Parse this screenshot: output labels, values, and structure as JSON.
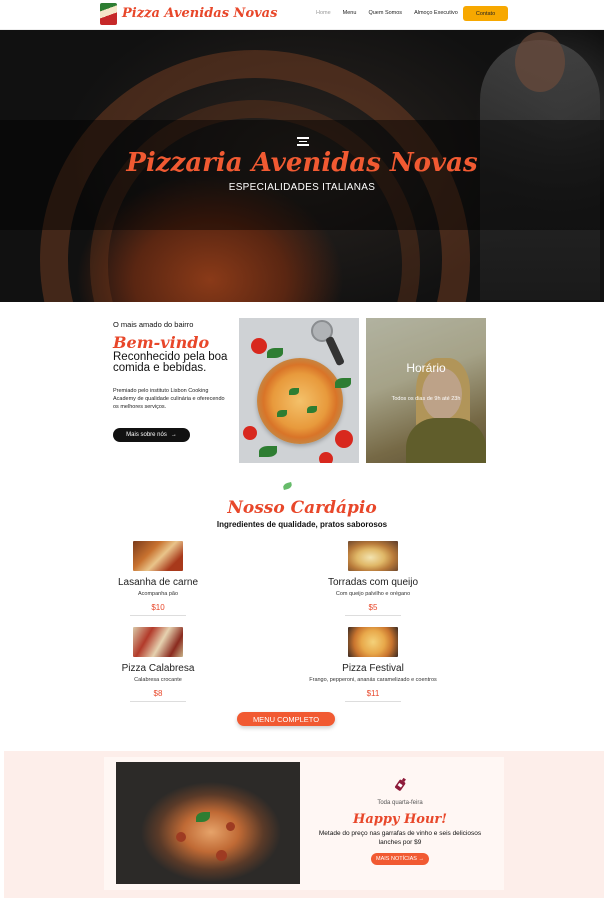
{
  "nav": {
    "brand": "Pizza Avenidas Novas",
    "links": [
      "Home",
      "Menu",
      "Quem Somos",
      "Almoço Executivo"
    ],
    "contact_label": "Contato",
    "accent": "#f7a800"
  },
  "hero": {
    "title": "Pizzaria Avenidas Novas",
    "subtitle": "ESPECIALIDADES ITALIANAS"
  },
  "welcome": {
    "kicker": "O mais amado do bairro",
    "title": "Bem-vindo",
    "subtitle": "Reconhecido pela boa comida e bebidas.",
    "description": "Premiado pelo instituto Lisbon Cooking Academy de qualidade culinária e oferecendo os melhores serviços.",
    "button_label": "Mais sobre nós",
    "button_arrow": "→"
  },
  "hours": {
    "title": "Horário",
    "text": "Todos os dias de 9h até 23h"
  },
  "menu": {
    "title": "Nosso Cardápio",
    "subtitle": "Ingredientes de qualidade, pratos saborosos",
    "items": [
      {
        "name": "Lasanha de carne",
        "desc": "Acompanha pão",
        "price": "$10"
      },
      {
        "name": "Torradas com queijo",
        "desc": "Com queijo palvilho e orégano",
        "price": "$5"
      },
      {
        "name": "Pizza Calabresa",
        "desc": "Calabresa crocante",
        "price": "$8"
      },
      {
        "name": "Pizza Festival",
        "desc": "Frango, pepperoni, ananás caramelizado e coentros",
        "price": "$11"
      }
    ],
    "button_label": "MENU COMPLETO"
  },
  "promo": {
    "kicker": "Toda quarta-feira",
    "title": "Happy Hour!",
    "text": "Metade do preço nas garrafas de vinho e seis deliciosos lanches por $9",
    "button_label": "MAIS NOTÍCIAS →"
  },
  "colors": {
    "brand_red": "#e8472a",
    "button_orange": "#f15a32",
    "promo_bg": "#fdeeea"
  }
}
